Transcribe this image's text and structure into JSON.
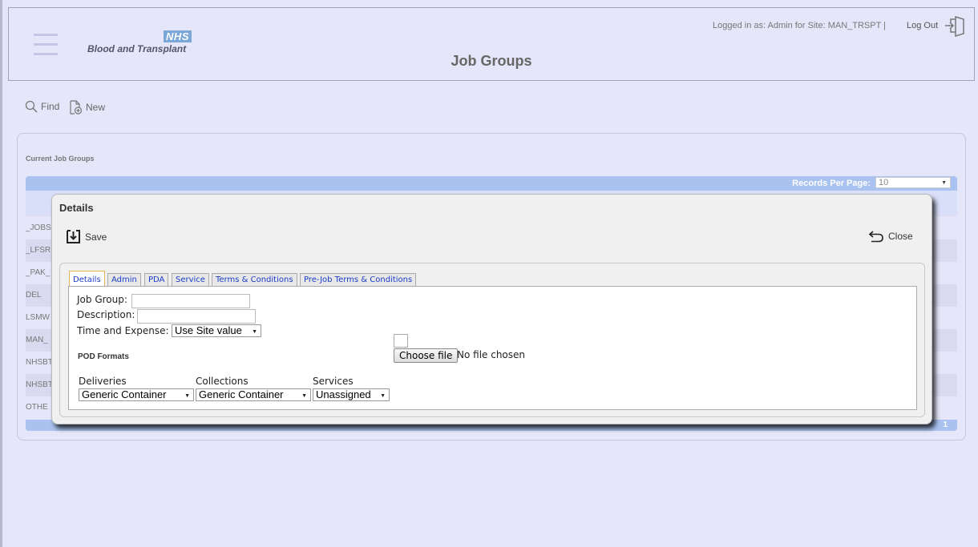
{
  "header": {
    "logo_badge": "NHS",
    "logo_text": "Blood and Transplant",
    "logged_in": "Logged in as: Admin for Site: MAN_TRSPT |",
    "logout_label": "Log Out",
    "title": "Job Groups"
  },
  "toolbar": {
    "find_label": "Find",
    "new_label": "New"
  },
  "grid": {
    "title": "Current Job Groups",
    "records_per_page_label": "Records Per Page:",
    "records_per_page_value": "10",
    "rows": [
      "_JOBS",
      "_LFSR",
      "_PAK_",
      "DEL",
      "LSMW",
      "MAN_",
      "NHSBT",
      "NHSBT",
      "OTHE"
    ],
    "page": "1"
  },
  "dialog": {
    "title": "Details",
    "save_label": "Save",
    "close_label": "Close",
    "tabs": [
      "Details",
      "Admin",
      "PDA",
      "Service",
      "Terms & Conditions",
      "Pre-Job Terms & Conditions"
    ],
    "job_group_label": "Job Group:",
    "job_group_value": "",
    "description_label": "Description:",
    "description_value": "",
    "time_expense_label": "Time and Expense:",
    "time_expense_value": "Use Site value",
    "pod_label": "POD Formats",
    "choose_file_label": "Choose file",
    "no_file_label": "No file chosen",
    "deliveries_label": "Deliveries",
    "deliveries_value": "Generic Container",
    "collections_label": "Collections",
    "collections_value": "Generic Container",
    "services_label": "Services",
    "services_value": "Unassigned"
  }
}
